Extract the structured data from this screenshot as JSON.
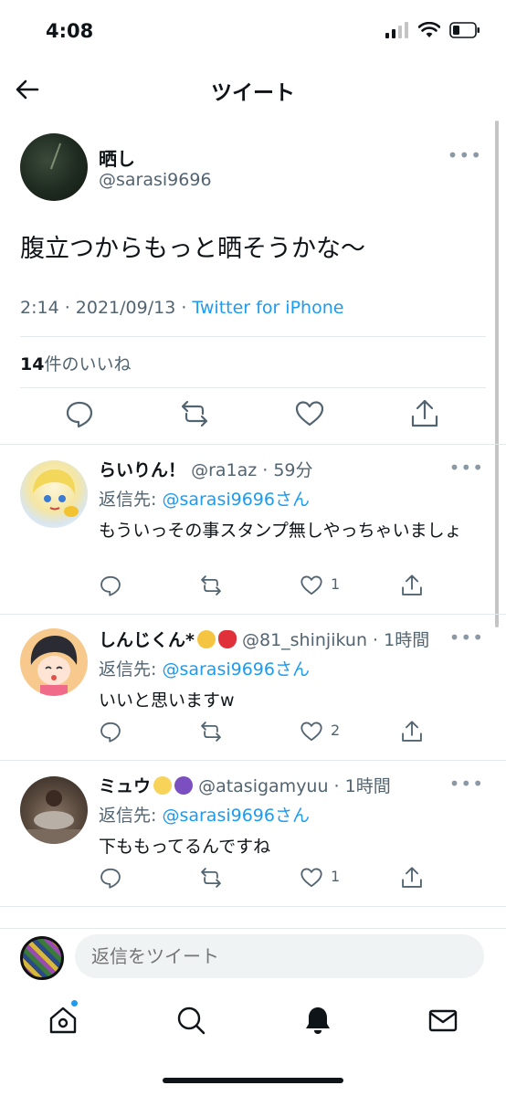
{
  "status_bar": {
    "time": "4:08"
  },
  "nav": {
    "title": "ツイート"
  },
  "main_tweet": {
    "name": "晒し",
    "handle": "@sarasi9696",
    "text": "腹立つからもっと晒そうかな〜",
    "time_date": "2:14 · 2021/09/13 · ",
    "source": "Twitter for iPhone",
    "likes_count": "14",
    "likes_label": "件のいいね"
  },
  "replies": [
    {
      "name": "らいりん！",
      "meta": "@ra1az · 59分",
      "reply_prefix": "返信先: ",
      "reply_mention": "@sarasi9696さん",
      "text": "もういっその事スタンプ無しやっちゃいましょ",
      "like_count": "1"
    },
    {
      "name": "しんじくん*",
      "meta": "@81_shinjikun · 1時間",
      "reply_prefix": "返信先: ",
      "reply_mention": "@sarasi9696さん",
      "text": "いいと思いますw",
      "like_count": "2"
    },
    {
      "name": "ミュウ",
      "meta": "@atasigamyuu · 1時間",
      "reply_prefix": "返信先: ",
      "reply_mention": "@sarasi9696さん",
      "text": "下ももってるんですね",
      "like_count": "1"
    }
  ],
  "compose": {
    "placeholder": "返信をツイート"
  },
  "colors": {
    "accent": "#1d9bf0",
    "muted": "#536471",
    "text": "#0f1419"
  },
  "icons": [
    "back-arrow-icon",
    "reply-icon",
    "retweet-icon",
    "like-icon",
    "share-icon",
    "more-icon",
    "home-icon",
    "search-icon",
    "bell-icon",
    "mail-icon"
  ]
}
